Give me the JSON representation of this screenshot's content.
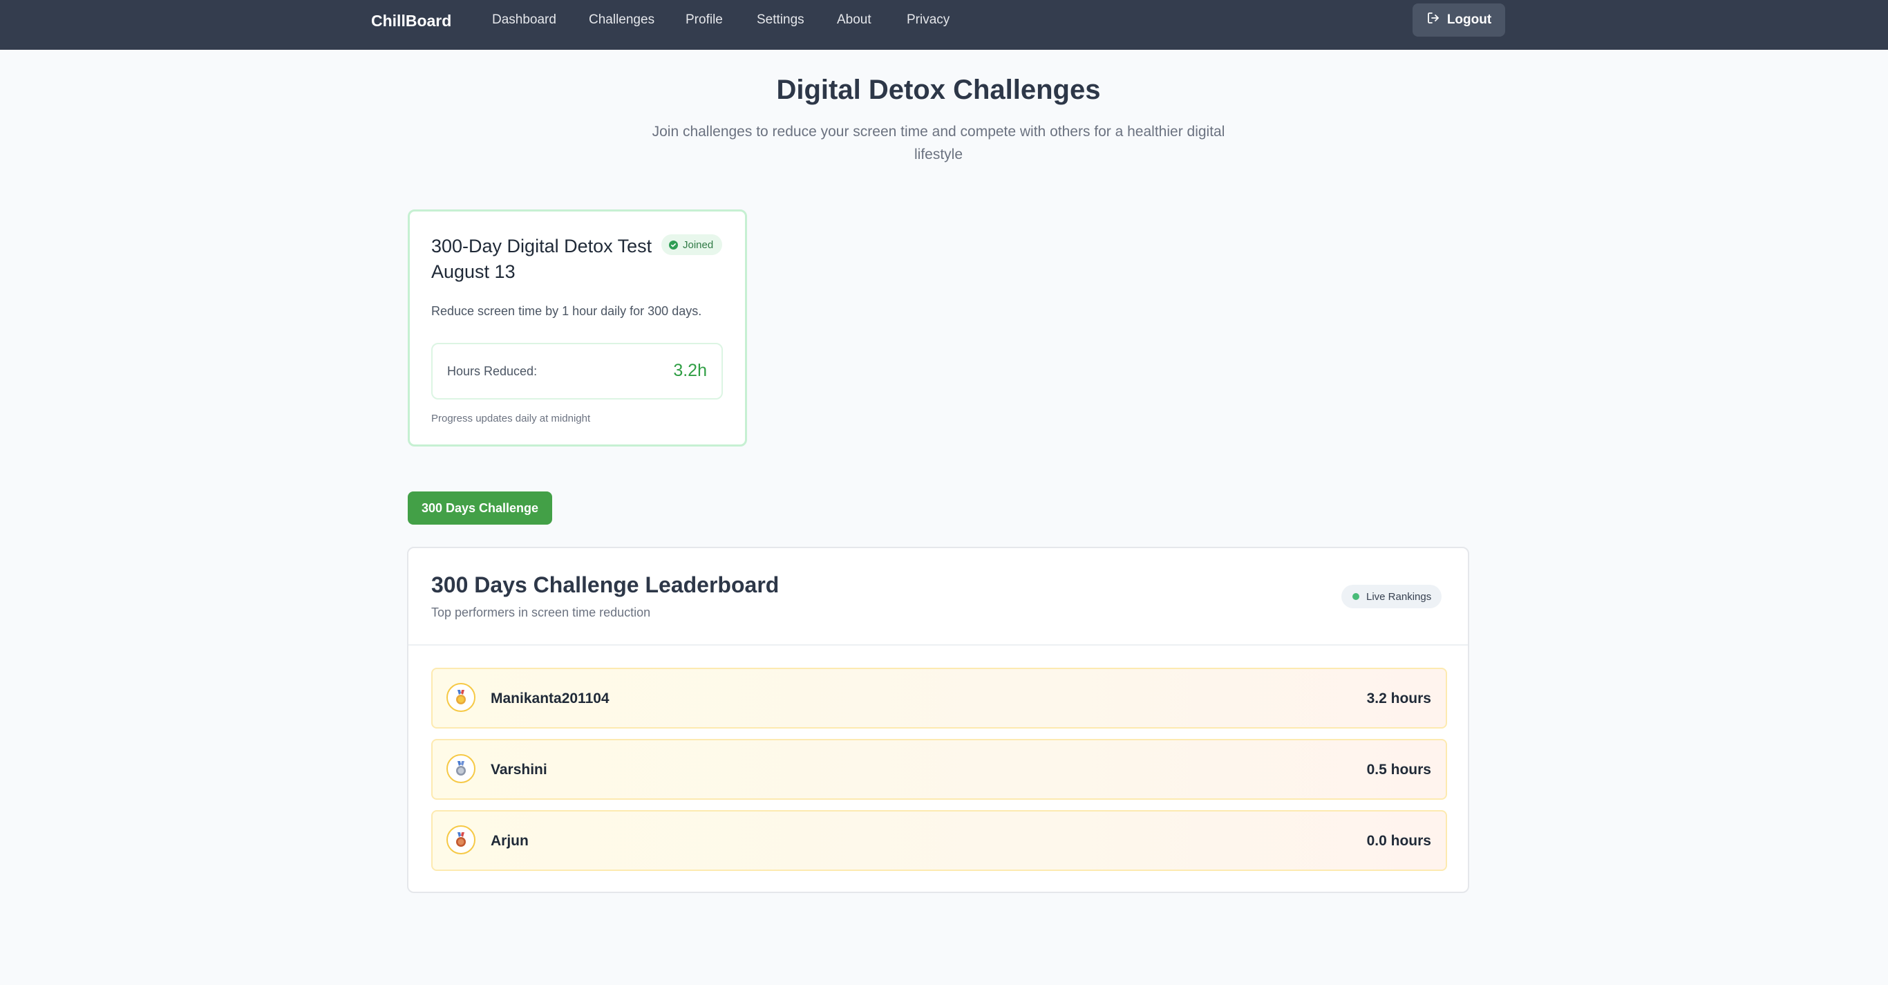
{
  "nav": {
    "brand": "ChillBoard",
    "links": [
      "Dashboard",
      "Challenges",
      "Profile",
      "Settings",
      "About",
      "Privacy"
    ],
    "logout_label": "Logout"
  },
  "header": {
    "title": "Digital Detox Challenges",
    "subtitle": "Join challenges to reduce your screen time and compete with others for a healthier digital lifestyle"
  },
  "challenge_card": {
    "title": "300-Day Digital Detox Test August 13",
    "badge": "Joined",
    "description": "Reduce screen time by 1 hour daily for 300 days.",
    "hours_label": "Hours Reduced:",
    "hours_value": "3.2h",
    "note": "Progress updates daily at midnight"
  },
  "tab": {
    "label": "300 Days Challenge"
  },
  "leaderboard": {
    "title": "300 Days Challenge Leaderboard",
    "subtitle": "Top performers in screen time reduction",
    "live_badge": "Live Rankings",
    "rows": [
      {
        "name": "Manikanta201104",
        "hours": "3.2 hours",
        "medal": "gold-medal-icon"
      },
      {
        "name": "Varshini",
        "hours": "0.5 hours",
        "medal": "silver-medal-icon"
      },
      {
        "name": "Arjun",
        "hours": "0.0 hours",
        "medal": "bronze-medal-icon"
      }
    ]
  },
  "colors": {
    "navbar": "#343d4e",
    "accent_green": "#43a047",
    "gold": "#f6c945",
    "silver": "#9aa3b5",
    "bronze": "#d9734a"
  }
}
